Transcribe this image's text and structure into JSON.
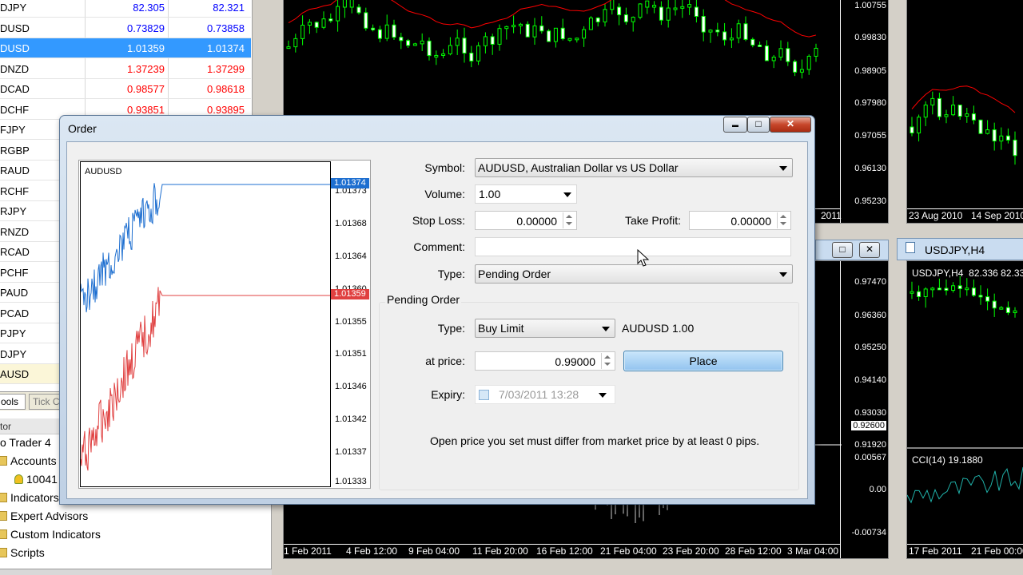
{
  "market_watch": {
    "rows": [
      {
        "symbol": "DJPY",
        "bid": "82.305",
        "ask": "82.321",
        "color": "blue"
      },
      {
        "symbol": "DUSD",
        "bid": "0.73829",
        "ask": "0.73858",
        "color": "blue"
      },
      {
        "symbol": "DUSD",
        "bid": "1.01359",
        "ask": "1.01374",
        "color": "white",
        "selected": true
      },
      {
        "symbol": "DNZD",
        "bid": "1.37239",
        "ask": "1.37299",
        "color": "red"
      },
      {
        "symbol": "DCAD",
        "bid": "0.98577",
        "ask": "0.98618",
        "color": "red"
      },
      {
        "symbol": "DCHF",
        "bid": "0.93851",
        "ask": "0.93895",
        "color": "red"
      },
      {
        "symbol": "FJPY",
        "bid": "",
        "ask": "",
        "color": "blue"
      },
      {
        "symbol": "RGBP",
        "bid": "",
        "ask": "",
        "color": "blue"
      },
      {
        "symbol": "RAUD",
        "bid": "",
        "ask": "",
        "color": "blue"
      },
      {
        "symbol": "RCHF",
        "bid": "",
        "ask": "",
        "color": "blue"
      },
      {
        "symbol": "RJPY",
        "bid": "",
        "ask": "",
        "color": "blue"
      },
      {
        "symbol": "RNZD",
        "bid": "",
        "ask": "",
        "color": "blue"
      },
      {
        "symbol": "RCAD",
        "bid": "",
        "ask": "",
        "color": "blue"
      },
      {
        "symbol": "PCHF",
        "bid": "",
        "ask": "",
        "color": "blue"
      },
      {
        "symbol": "PAUD",
        "bid": "",
        "ask": "",
        "color": "blue"
      },
      {
        "symbol": "PCAD",
        "bid": "",
        "ask": "",
        "color": "blue"
      },
      {
        "symbol": "PJPY",
        "bid": "",
        "ask": "",
        "color": "blue"
      },
      {
        "symbol": "DJPY",
        "bid": "",
        "ask": "",
        "color": "blue"
      },
      {
        "symbol": "AUSD",
        "bid": "",
        "ask": "",
        "color": "blue",
        "highlight": true
      }
    ],
    "tabs": [
      "ools",
      "Tick C"
    ]
  },
  "navigator": {
    "header": "tor",
    "items": [
      {
        "label": "o Trader 4",
        "icon": "terminal-icon"
      },
      {
        "label": "Accounts",
        "icon": "folder-icon"
      },
      {
        "label": "10041",
        "icon": "account-icon"
      },
      {
        "label": "Indicators",
        "icon": "folder-icon"
      },
      {
        "label": "Expert Advisors",
        "icon": "folder-icon"
      },
      {
        "label": "Custom Indicators",
        "icon": "folder-icon"
      },
      {
        "label": "Scripts",
        "icon": "folder-icon"
      }
    ]
  },
  "charts": {
    "main": {
      "prices": [
        "1.00755",
        "0.99830",
        "0.98905",
        "0.97980",
        "0.97055",
        "0.96130",
        "0.95230"
      ],
      "date_right": "2011"
    },
    "right_top": {
      "dates": [
        "23 Aug 2010",
        "14 Sep 2010"
      ]
    },
    "middle": {
      "prices": [
        "0.97470",
        "0.96360",
        "0.95250",
        "0.94140",
        "0.93030",
        "0.92600",
        "0.91920",
        "0.00567",
        "0.00",
        "-0.00734"
      ],
      "dates": [
        "1 Feb 2011",
        "4 Feb 12:00",
        "9 Feb 04:00",
        "11 Feb 20:00",
        "16 Feb 12:00",
        "21 Feb 04:00",
        "23 Feb 20:00",
        "28 Feb 12:00",
        "3 Mar 04:00"
      ]
    },
    "right_bottom": {
      "window_title": "USDJPY,H4",
      "label": "USDJPY,H4  82.336 82.33",
      "indicator": "CCI(14) 19.1880",
      "dates": [
        "17 Feb 2011",
        "21 Feb 00:00"
      ]
    }
  },
  "order_dialog": {
    "title": "Order",
    "window_buttons": {
      "minimize": "▬",
      "maximize": "□",
      "close": "✕"
    },
    "tick_chart": {
      "symbol": "AUDUSD",
      "ask_tag": "1.01374",
      "bid_tag": "1.01359",
      "prices": [
        "1.01373",
        "1.01368",
        "1.01364",
        "1.01360",
        "1.01355",
        "1.01351",
        "1.01346",
        "1.01342",
        "1.01337",
        "1.01333"
      ]
    },
    "form": {
      "symbol_label": "Symbol:",
      "symbol_value": "AUDUSD, Australian Dollar vs US Dollar",
      "volume_label": "Volume:",
      "volume_value": "1.00",
      "stop_loss_label": "Stop Loss:",
      "stop_loss_value": "0.00000",
      "take_profit_label": "Take Profit:",
      "take_profit_value": "0.00000",
      "comment_label": "Comment:",
      "comment_value": "",
      "type_label": "Type:",
      "type_value": "Pending Order"
    },
    "pending": {
      "group_label": "Pending Order",
      "type_label": "Type:",
      "type_value": "Buy Limit",
      "order_summary": "AUDUSD 1.00",
      "price_label": "at price:",
      "price_value": "0.99000",
      "place_label": "Place",
      "expiry_label": "Expiry:",
      "expiry_value": "7/03/2011 13:28",
      "note": "Open price you set must differ from market price by at least 0 pips."
    }
  },
  "colors": {
    "bid_up": "#0000ff",
    "bid_down": "#ff0000",
    "selection": "#3399ff",
    "candle": "#00ff00",
    "ma_line": "#ff0000"
  }
}
